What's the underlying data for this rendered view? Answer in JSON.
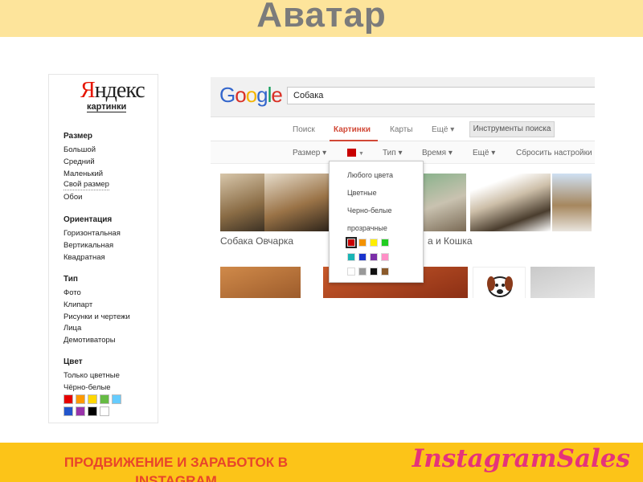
{
  "slide": {
    "title": "Аватар",
    "footer_text": "ПРОДВИЖЕНИЕ И ЗАРАБОТОК В INSTAGRAM",
    "footer_logo": "InstagramSales",
    "colors": {
      "header_bg": "#fde49b",
      "footer_bg": "#fcc418",
      "footer_text": "#e8452b",
      "logo": "#e5337a"
    }
  },
  "yandex": {
    "logo": "Яндекс",
    "logo_first_letter": "Я",
    "logo_rest": "ндекс",
    "subtitle": "картинки",
    "groups": [
      {
        "heading": "Размер",
        "items": [
          "Большой",
          "Средний",
          "Маленький",
          "Свой размер",
          "Обои"
        ]
      },
      {
        "heading": "Ориентация",
        "items": [
          "Горизонтальная",
          "Вертикальная",
          "Квадратная"
        ]
      },
      {
        "heading": "Тип",
        "items": [
          "Фото",
          "Клипарт",
          "Рисунки и чертежи",
          "Лица",
          "Демотиваторы"
        ]
      },
      {
        "heading": "Цвет",
        "items": [
          "Только цветные",
          "Чёрно-белые"
        ]
      }
    ],
    "color_swatches": [
      "#e60000",
      "#ff9900",
      "#ffd700",
      "#66bb44",
      "#66ccff",
      "#2255cc",
      "#9933aa",
      "#000000",
      "#ffffff"
    ]
  },
  "google": {
    "logo_letters": [
      "G",
      "o",
      "o",
      "g",
      "l",
      "e"
    ],
    "search_value": "Собака",
    "tabs": [
      "Поиск",
      "Картинки",
      "Карты",
      "Ещё ▾"
    ],
    "tools_button": "Инструменты поиска",
    "filters": [
      "Размер ▾",
      "Тип ▾",
      "Время ▾",
      "Ещё ▾",
      "Сбросить настройки"
    ],
    "color_filter_value": "#c80000",
    "captions": [
      "Собака Овчарка",
      "а и Кошка"
    ],
    "dropdown": {
      "items": [
        "Любого цвета",
        "Цветные",
        "Черно-белые",
        "прозрачные"
      ],
      "swatches": [
        "#c80000",
        "#f39200",
        "#ffee00",
        "#22cc22",
        "#1ab5b5",
        "#1a33cc",
        "#7b2fa8",
        "#ff8fc7",
        "#ffffff",
        "#999999",
        "#111111",
        "#8b5a2b"
      ],
      "selected_swatch": 0
    }
  }
}
